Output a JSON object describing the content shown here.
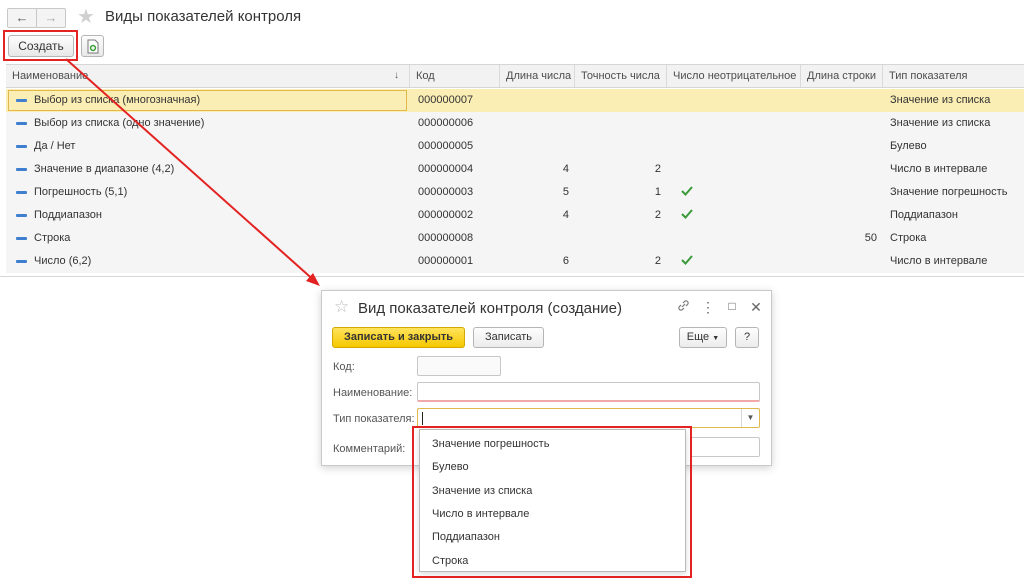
{
  "window": {
    "title": "Виды показателей контроля"
  },
  "toolbar": {
    "create_label": "Создать"
  },
  "table": {
    "columns": [
      "Наименование",
      "Код",
      "Длина числа",
      "Точность числа",
      "Число неотрицательное",
      "Длина строки",
      "Тип показателя"
    ],
    "rows": [
      {
        "name": "Выбор из списка (многозначная)",
        "code": "000000007",
        "length": "",
        "precision": "",
        "nonneg": false,
        "strlen": "",
        "type": "Значение из списка"
      },
      {
        "name": "Выбор из списка (одно значение)",
        "code": "000000006",
        "length": "",
        "precision": "",
        "nonneg": false,
        "strlen": "",
        "type": "Значение из списка"
      },
      {
        "name": "Да / Нет",
        "code": "000000005",
        "length": "",
        "precision": "",
        "nonneg": false,
        "strlen": "",
        "type": "Булево"
      },
      {
        "name": "Значение в диапазоне (4,2)",
        "code": "000000004",
        "length": "4",
        "precision": "2",
        "nonneg": false,
        "strlen": "",
        "type": "Число в интервале"
      },
      {
        "name": "Погрешность (5,1)",
        "code": "000000003",
        "length": "5",
        "precision": "1",
        "nonneg": true,
        "strlen": "",
        "type": "Значение погрешность"
      },
      {
        "name": "Поддиапазон",
        "code": "000000002",
        "length": "4",
        "precision": "2",
        "nonneg": true,
        "strlen": "",
        "type": "Поддиапазон"
      },
      {
        "name": "Строка",
        "code": "000000008",
        "length": "",
        "precision": "",
        "nonneg": false,
        "strlen": "50",
        "type": "Строка"
      },
      {
        "name": "Число (6,2)",
        "code": "000000001",
        "length": "6",
        "precision": "2",
        "nonneg": true,
        "strlen": "",
        "type": "Число в интервале"
      }
    ]
  },
  "dialog": {
    "title": "Вид показателей контроля (создание)",
    "save_close_label": "Записать и закрыть",
    "save_label": "Записать",
    "more_label": "Еще",
    "help_label": "?",
    "fields": {
      "code_label": "Код:",
      "name_label": "Наименование:",
      "type_label": "Тип показателя:",
      "comment_label": "Комментарий:"
    }
  },
  "dropdown": {
    "options": [
      "Значение погрешность",
      "Булево",
      "Значение из списка",
      "Число в интервале",
      "Поддиапазон",
      "Строка"
    ]
  },
  "colors": {
    "highlight_red": "#e32222",
    "selected_row": "#fbeeb5",
    "primary_button": "#f5c800",
    "check_green": "#3a9a3a",
    "row_marker_blue": "#3f7fcf"
  }
}
